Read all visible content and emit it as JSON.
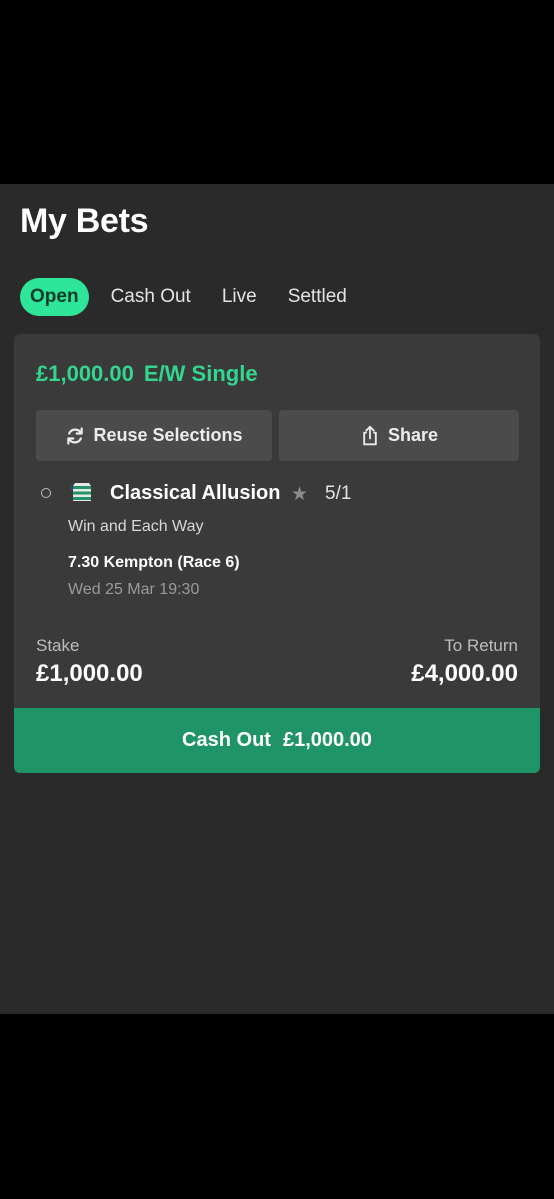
{
  "page": {
    "title": "My Bets"
  },
  "tabs": [
    {
      "label": "Open",
      "active": true
    },
    {
      "label": "Cash Out",
      "active": false
    },
    {
      "label": "Live",
      "active": false
    },
    {
      "label": "Settled",
      "active": false
    }
  ],
  "bet": {
    "amount": "£1,000.00",
    "type": "E/W Single",
    "reuse_label": "Reuse Selections",
    "share_label": "Share",
    "selection": {
      "runner": "Classical Allusion",
      "odds": "5/1",
      "market": "Win and Each Way",
      "event": "7.30 Kempton (Race 6)",
      "event_time": "Wed 25 Mar 19:30"
    },
    "stake_label": "Stake",
    "stake_value": "£1,000.00",
    "return_label": "To Return",
    "return_value": "£4,000.00",
    "cashout_label": "Cash Out",
    "cashout_value": "£1,000.00"
  },
  "colors": {
    "accent": "#2ee59a",
    "cashout": "#1f9466",
    "card": "#3a3a3a",
    "background": "#2a2a2a"
  },
  "icons": [
    "refresh-icon",
    "share-icon",
    "silks-icon",
    "star-icon"
  ]
}
